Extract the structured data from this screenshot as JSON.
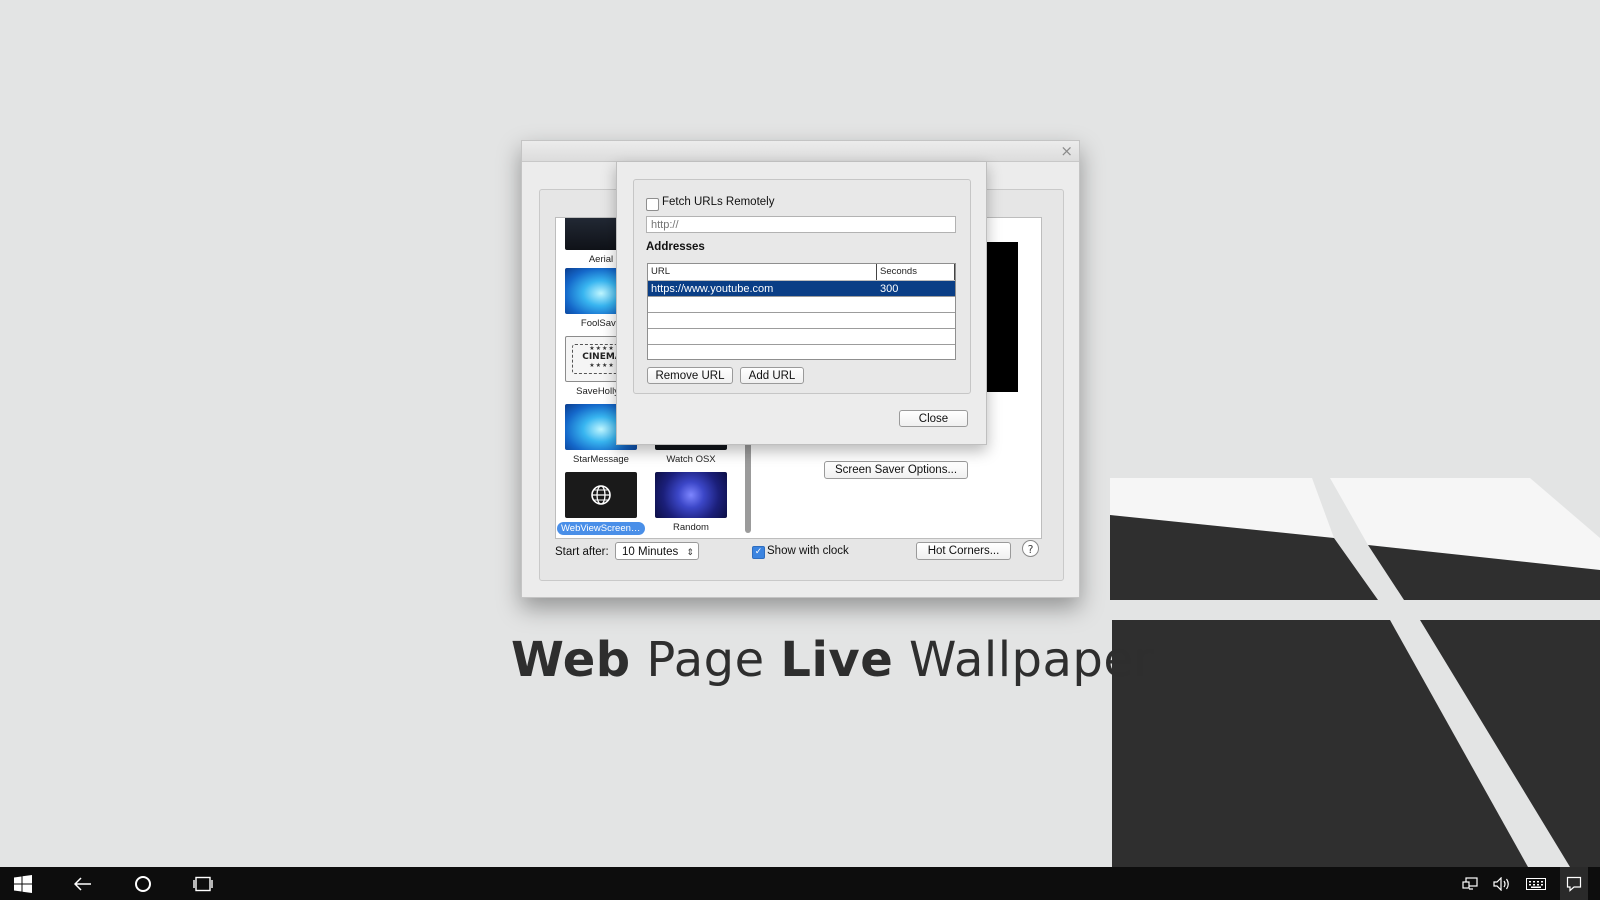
{
  "wallpaper": {
    "headline": {
      "word1": "Web",
      "word2": "Page",
      "word3": "Live",
      "word4": "Wallpaper"
    },
    "colors": {
      "background": "#e3e4e4",
      "graphic_dark": "#2f2f2f",
      "graphic_light": "#f6f6f6"
    }
  },
  "prefs_window": {
    "close_glyph": "×",
    "screensavers": [
      {
        "label": "Aerial",
        "thumb": "dark",
        "selected": false
      },
      {
        "label": "FoolSave",
        "thumb": "blue",
        "selected": false
      },
      {
        "label": "SaveHollyw",
        "thumb": "cinema",
        "selected": false
      },
      {
        "label": "StarMessage",
        "thumb": "blue",
        "selected": false
      },
      {
        "label": "Watch OSX",
        "thumb": "dark",
        "selected": false
      },
      {
        "label": "WebViewScreenS...",
        "thumb": "web",
        "selected": true
      },
      {
        "label": "Random",
        "thumb": "random",
        "selected": false
      }
    ],
    "cinema_text": "CINEMA",
    "screen_saver_options_label": "Screen Saver Options...",
    "start_after_label": "Start after:",
    "start_after_value": "10 Minutes",
    "show_with_clock_label": "Show with clock",
    "show_with_clock_checked": true,
    "hot_corners_label": "Hot Corners...",
    "help_label": "?"
  },
  "url_sheet": {
    "fetch_remote_label": "Fetch URLs Remotely",
    "fetch_remote_checked": false,
    "remote_url_placeholder": "http://",
    "addresses_label": "Addresses",
    "table": {
      "columns": [
        "URL",
        "Seconds"
      ],
      "rows": [
        {
          "url": "https://www.youtube.com",
          "seconds": "300",
          "selected": true
        }
      ]
    },
    "remove_url_label": "Remove URL",
    "add_url_label": "Add URL",
    "close_label": "Close"
  },
  "taskbar": {
    "icons": [
      "windows-start-icon",
      "back-arrow-icon",
      "cortana-circle-icon",
      "task-view-icon",
      "network-icon",
      "volume-icon",
      "keyboard-icon",
      "action-center-icon"
    ]
  }
}
